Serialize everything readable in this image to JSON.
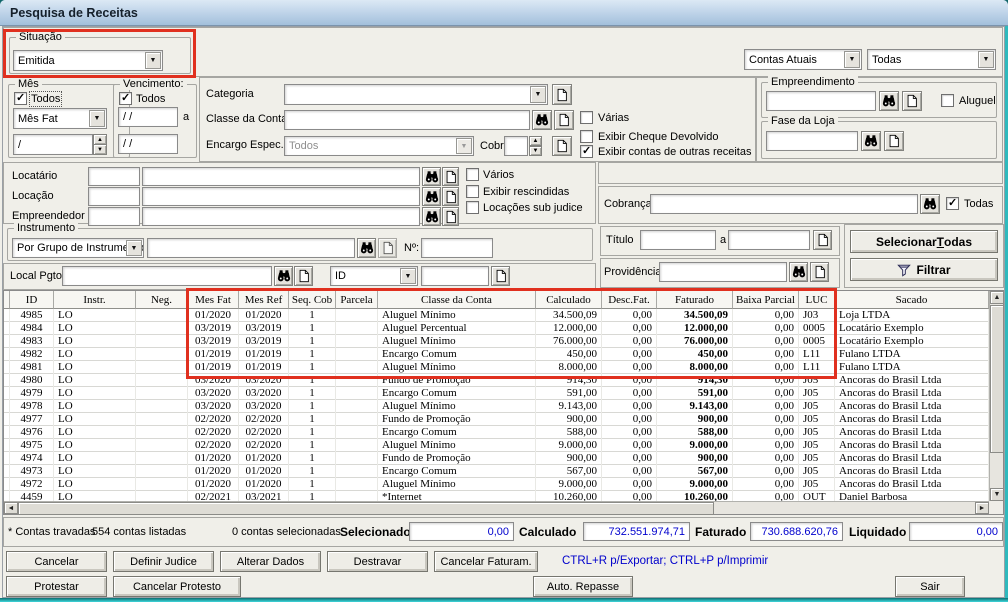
{
  "titlebar": {
    "title": "Pesquisa de Receitas"
  },
  "situacao": {
    "legend": "Situação",
    "value": "Emitida"
  },
  "scope": {
    "contas": "Contas Atuais",
    "abrangencia": "Todas"
  },
  "mes": {
    "legend": "Mês",
    "todos": "Todos",
    "combo": "Mês Fat",
    "spin": "/"
  },
  "venc": {
    "legend": "Vencimento:",
    "todos": "Todos",
    "de": "/ /",
    "sep": "a",
    "ate": "/ /"
  },
  "conta": {
    "categoria": "Categoria",
    "classe": "Classe da Conta",
    "encargo": "Encargo Espec.",
    "encargo_value": "Todos",
    "cobr": "Cobr",
    "varias": "Várias",
    "cheque": "Exibir Cheque Devolvido",
    "outras": "Exibir contas de outras receitas"
  },
  "empreendimento": {
    "legend": "Empreendimento",
    "aluguel": "Aluguel"
  },
  "fase": {
    "legend": "Fase da Loja"
  },
  "partes": {
    "locatario": "Locatário",
    "locacao": "Locação",
    "empreendedor": "Empreendedor",
    "varios": "Vários",
    "rescindidas": "Exibir rescindidas",
    "subjudice": "Locações sub judice"
  },
  "cobranca": {
    "label": "Cobrança",
    "todas": "Todas"
  },
  "instrumento": {
    "legend": "Instrumento",
    "combo": "Por Grupo de Instrumento",
    "numero": "Nº:"
  },
  "pgto": {
    "local": "Local Pgto",
    "id_combo": "ID"
  },
  "titulo": {
    "label": "Título",
    "sep": "a"
  },
  "providencia": {
    "label": "Providência"
  },
  "filter_buttons": {
    "selecionar_pre": "Selecionar ",
    "selecionar_key": "T",
    "selecionar_post": "odas",
    "filtrar": "Filtrar"
  },
  "checks": {
    "mes_todos": true,
    "venc_todos": true,
    "varias": false,
    "cheque": false,
    "outras": true,
    "aluguel": false,
    "varios": false,
    "rescindidas": false,
    "subjudice": false,
    "cobranca_todas": true
  },
  "grid": {
    "columns": [
      "ID",
      "Instr.",
      "Neg.",
      "Mes Fat",
      "Mes Ref",
      "Seq. Cob",
      "Parcela",
      "Classe da Conta",
      "Calculado",
      "Desc.Fat.",
      "Faturado",
      "Baixa Parcial",
      "LUC",
      "Sacado"
    ],
    "rows": [
      [
        "4985",
        "LO",
        "",
        "01/2020",
        "01/2020",
        "1",
        "",
        "Aluguel Mínimo",
        "34.500,09",
        "0,00",
        "34.500,09",
        "0,00",
        "J03",
        "Loja LTDA"
      ],
      [
        "4984",
        "LO",
        "",
        "03/2019",
        "03/2019",
        "1",
        "",
        "Aluguel Percentual",
        "12.000,00",
        "0,00",
        "12.000,00",
        "0,00",
        "0005",
        "Locatário Exemplo"
      ],
      [
        "4983",
        "LO",
        "",
        "03/2019",
        "03/2019",
        "1",
        "",
        "Aluguel Mínimo",
        "76.000,00",
        "0,00",
        "76.000,00",
        "0,00",
        "0005",
        "Locatário Exemplo"
      ],
      [
        "4982",
        "LO",
        "",
        "01/2019",
        "01/2019",
        "1",
        "",
        "Encargo Comum",
        "450,00",
        "0,00",
        "450,00",
        "0,00",
        "L11",
        "Fulano LTDA"
      ],
      [
        "4981",
        "LO",
        "",
        "01/2019",
        "01/2019",
        "1",
        "",
        "Aluguel Mínimo",
        "8.000,00",
        "0,00",
        "8.000,00",
        "0,00",
        "L11",
        "Fulano LTDA"
      ],
      [
        "4980",
        "LO",
        "",
        "03/2020",
        "03/2020",
        "1",
        "",
        "Fundo de Promoção",
        "914,30",
        "0,00",
        "914,30",
        "0,00",
        "J05",
        "Ancoras do Brasil Ltda"
      ],
      [
        "4979",
        "LO",
        "",
        "03/2020",
        "03/2020",
        "1",
        "",
        "Encargo Comum",
        "591,00",
        "0,00",
        "591,00",
        "0,00",
        "J05",
        "Ancoras do Brasil Ltda"
      ],
      [
        "4978",
        "LO",
        "",
        "03/2020",
        "03/2020",
        "1",
        "",
        "Aluguel Mínimo",
        "9.143,00",
        "0,00",
        "9.143,00",
        "0,00",
        "J05",
        "Ancoras do Brasil Ltda"
      ],
      [
        "4977",
        "LO",
        "",
        "02/2020",
        "02/2020",
        "1",
        "",
        "Fundo de Promoção",
        "900,00",
        "0,00",
        "900,00",
        "0,00",
        "J05",
        "Ancoras do Brasil Ltda"
      ],
      [
        "4976",
        "LO",
        "",
        "02/2020",
        "02/2020",
        "1",
        "",
        "Encargo Comum",
        "588,00",
        "0,00",
        "588,00",
        "0,00",
        "J05",
        "Ancoras do Brasil Ltda"
      ],
      [
        "4975",
        "LO",
        "",
        "02/2020",
        "02/2020",
        "1",
        "",
        "Aluguel Mínimo",
        "9.000,00",
        "0,00",
        "9.000,00",
        "0,00",
        "J05",
        "Ancoras do Brasil Ltda"
      ],
      [
        "4974",
        "LO",
        "",
        "01/2020",
        "01/2020",
        "1",
        "",
        "Fundo de Promoção",
        "900,00",
        "0,00",
        "900,00",
        "0,00",
        "J05",
        "Ancoras do Brasil Ltda"
      ],
      [
        "4973",
        "LO",
        "",
        "01/2020",
        "01/2020",
        "1",
        "",
        "Encargo Comum",
        "567,00",
        "0,00",
        "567,00",
        "0,00",
        "J05",
        "Ancoras do Brasil Ltda"
      ],
      [
        "4972",
        "LO",
        "",
        "01/2020",
        "01/2020",
        "1",
        "",
        "Aluguel Mínimo",
        "9.000,00",
        "0,00",
        "9.000,00",
        "0,00",
        "J05",
        "Ancoras do Brasil Ltda"
      ],
      [
        "4459",
        "LO",
        "",
        "02/2021",
        "03/2021",
        "1",
        "",
        "*Internet",
        "10.260,00",
        "0,00",
        "10.260,00",
        "0,00",
        "OUT",
        "Daniel Barbosa"
      ]
    ]
  },
  "status": {
    "travadas": "* Contas travadas",
    "listadas": "554 contas listadas",
    "selecionadas": "0 contas selecionadas",
    "selecionado": "Selecionado",
    "selecionado_value": "0,00",
    "calculado": "Calculado",
    "calculado_value": "732.551.974,71",
    "faturado": "Faturado",
    "faturado_value": "730.688.620,76",
    "liquidado": "Liquidado",
    "liquidado_value": "0,00"
  },
  "actions": {
    "cancelar": "Cancelar",
    "definir": "Definir Judice",
    "alterar": "Alterar Dados",
    "destravar": "Destravar",
    "cancelar_faturam": "Cancelar Faturam.",
    "hint": "CTRL+R p/Exportar; CTRL+P p/Imprimir",
    "protestar": "Protestar",
    "cancelar_protesto": "Cancelar Protesto",
    "auto_repasse": "Auto. Repasse",
    "sair": "Sair"
  },
  "colors": {
    "highlight_red": "#e0301f",
    "value_blue": "#0000cd"
  }
}
